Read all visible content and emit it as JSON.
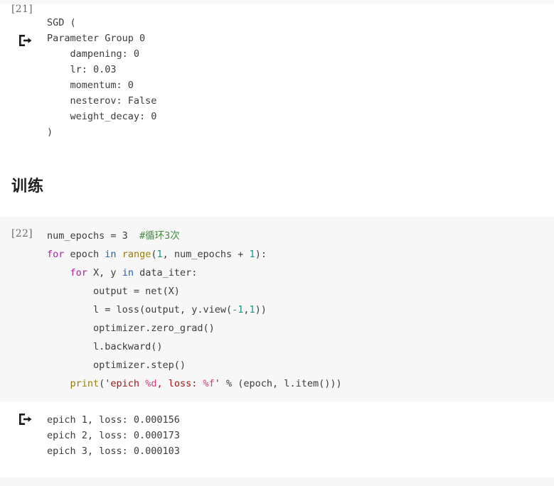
{
  "notebook": {
    "cells": [
      {
        "kind": "output",
        "exec_label": "[21]",
        "icon": "output-arrow-icon",
        "lines": [
          "SGD (",
          "Parameter Group 0",
          "    dampening: 0",
          "    lr: 0.03",
          "    momentum: 0",
          "    nesterov: False",
          "    weight_decay: 0",
          ")"
        ]
      },
      {
        "kind": "markdown",
        "heading": "训练"
      },
      {
        "kind": "code",
        "exec_label": "[22]",
        "language": "python",
        "lines": [
          {
            "tokens": [
              {
                "t": "num_epochs = 3  ",
                "c": "plain"
              },
              {
                "t": "#循环3次",
                "c": "com"
              }
            ]
          },
          {
            "tokens": [
              {
                "t": "for",
                "c": "kw"
              },
              {
                "t": " epoch ",
                "c": "plain"
              },
              {
                "t": "in",
                "c": "kw2"
              },
              {
                "t": " ",
                "c": "plain"
              },
              {
                "t": "range",
                "c": "fn"
              },
              {
                "t": "(",
                "c": "plain"
              },
              {
                "t": "1",
                "c": "num"
              },
              {
                "t": ", num_epochs + ",
                "c": "plain"
              },
              {
                "t": "1",
                "c": "num"
              },
              {
                "t": "):",
                "c": "plain"
              }
            ]
          },
          {
            "tokens": [
              {
                "t": "    ",
                "c": "plain"
              },
              {
                "t": "for",
                "c": "kw"
              },
              {
                "t": " X, y ",
                "c": "plain"
              },
              {
                "t": "in",
                "c": "kw2"
              },
              {
                "t": " data_iter:",
                "c": "plain"
              }
            ]
          },
          {
            "tokens": [
              {
                "t": "        output = net(X)",
                "c": "plain"
              }
            ]
          },
          {
            "tokens": [
              {
                "t": "        l = loss(output, y.view(",
                "c": "plain"
              },
              {
                "t": "-1",
                "c": "num"
              },
              {
                "t": ",",
                "c": "plain"
              },
              {
                "t": "1",
                "c": "num"
              },
              {
                "t": "))",
                "c": "plain"
              }
            ]
          },
          {
            "tokens": [
              {
                "t": "        optimizer.zero_grad()",
                "c": "plain"
              }
            ]
          },
          {
            "tokens": [
              {
                "t": "        l.backward()",
                "c": "plain"
              }
            ]
          },
          {
            "tokens": [
              {
                "t": "        optimizer.step()",
                "c": "plain"
              }
            ]
          },
          {
            "tokens": [
              {
                "t": "    ",
                "c": "plain"
              },
              {
                "t": "print",
                "c": "fn"
              },
              {
                "t": "(",
                "c": "plain"
              },
              {
                "t": "'epich ",
                "c": "str"
              },
              {
                "t": "%d",
                "c": "fmt"
              },
              {
                "t": ", loss: ",
                "c": "str"
              },
              {
                "t": "%f",
                "c": "fmt"
              },
              {
                "t": "'",
                "c": "str"
              },
              {
                "t": " % (epoch, l.item()))",
                "c": "plain"
              }
            ]
          }
        ]
      },
      {
        "kind": "output",
        "exec_label": "",
        "icon": "output-arrow-icon",
        "lines": [
          "epich 1, loss: 0.000156",
          "epich 2, loss: 0.000173",
          "epich 3, loss: 0.000103"
        ]
      }
    ]
  },
  "theme": {
    "code_cell_bg": "#f7f7f7",
    "page_bg": "#ffffff",
    "text": "#3c3c3c",
    "exec_label": "#6b6b6b",
    "keyword": "#a626a4",
    "keyword_in": "#2060c0",
    "function": "#9a7d0a",
    "number": "#1a9188",
    "comment": "#3f8a3f",
    "string": "#a31515",
    "format_spec": "#d1417a"
  }
}
